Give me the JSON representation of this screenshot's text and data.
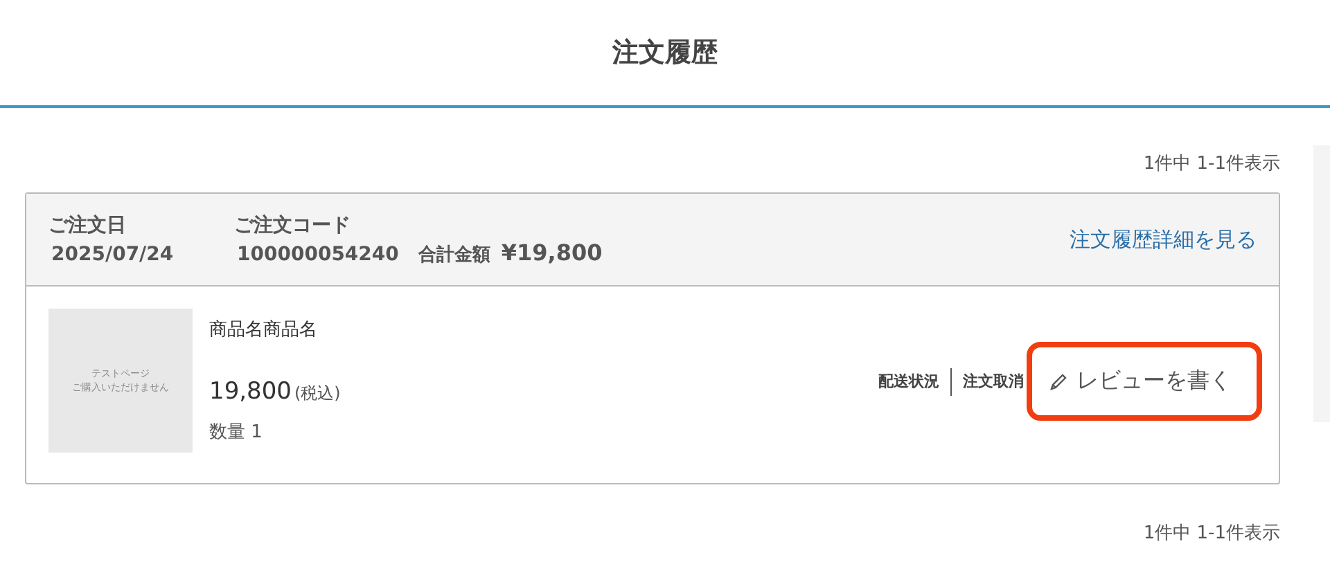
{
  "page_title": "注文履歴",
  "count_top": "1件中 1-1件表示",
  "orders": [
    {
      "date_label": "ご注文日",
      "date": "2025/07/24",
      "code_label": "ご注文コード",
      "code": "100000054240",
      "total_label": "合計金額",
      "total": "¥19,800",
      "detail_link": "注文履歴詳細を見る",
      "items": [
        {
          "image_text": [
            "テストページ",
            "ご購入いただけません"
          ],
          "name": "商品名商品名",
          "price": "19,800",
          "tax": "(税込)",
          "quantity": "数量 1",
          "actions": [
            "配送状況",
            "注文取消"
          ],
          "review": "レビューを書く",
          "review_highlighted": true
        }
      ]
    }
  ],
  "count_bottom": "1件中 1-1件表示"
}
